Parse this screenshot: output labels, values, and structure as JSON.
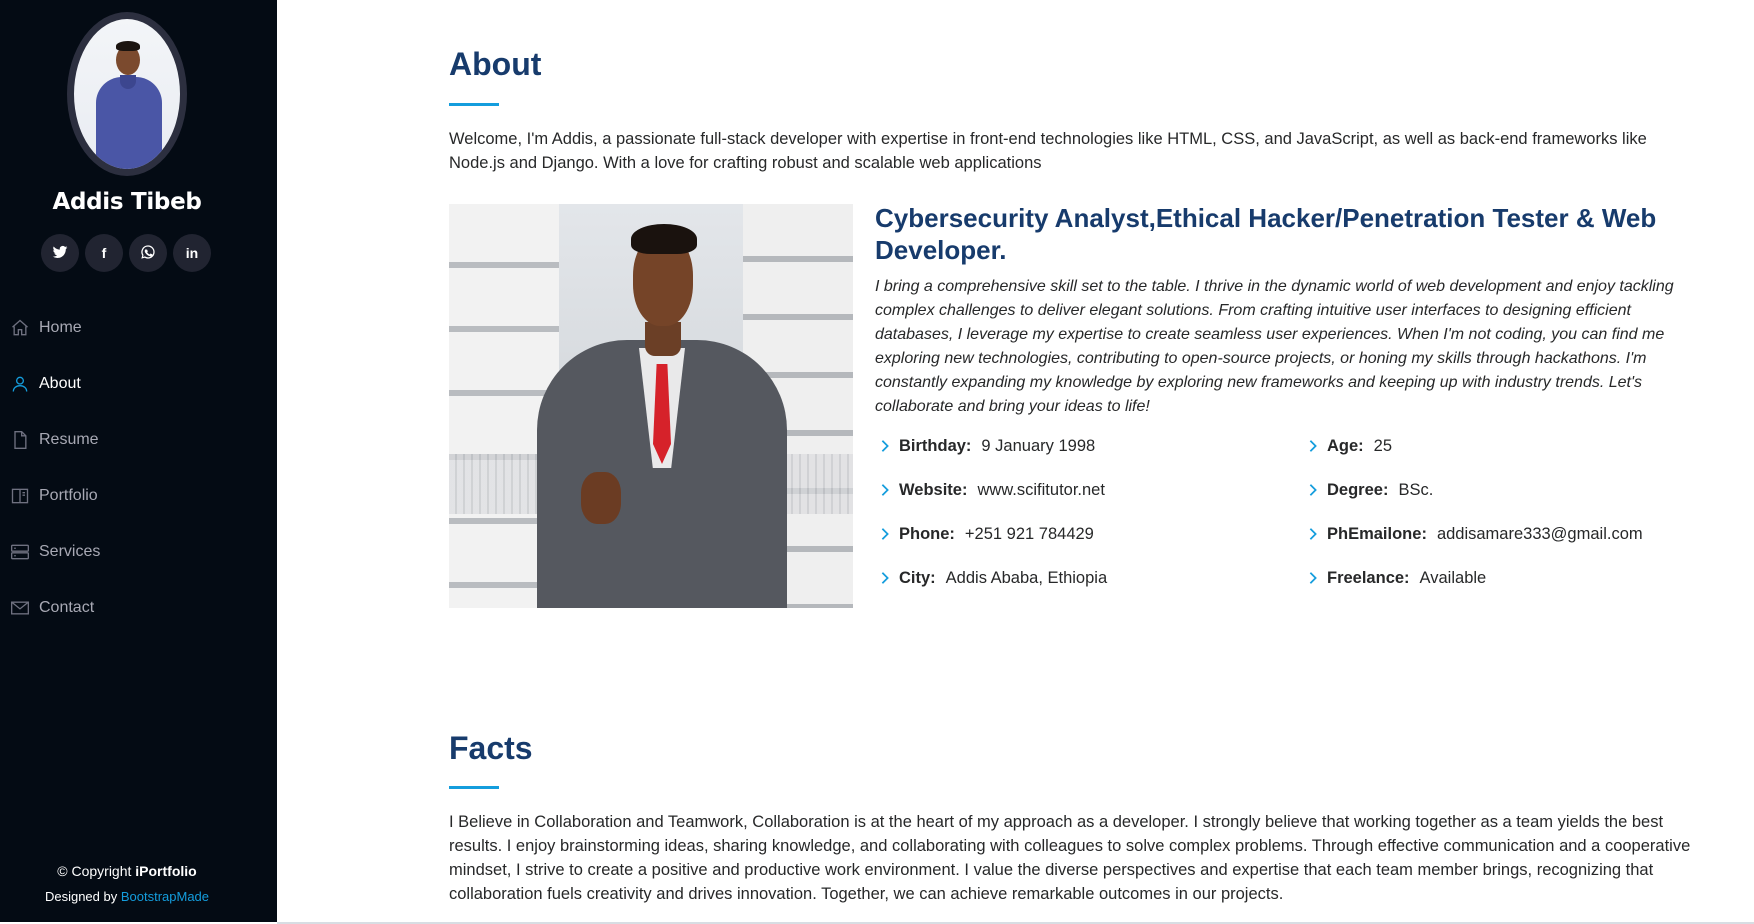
{
  "sidebar": {
    "name": "Addis Tibeb",
    "social": [
      {
        "icon": "twitter-icon",
        "glyph": ""
      },
      {
        "icon": "facebook-icon",
        "glyph": "f"
      },
      {
        "icon": "whatsapp-icon",
        "glyph": ""
      },
      {
        "icon": "linkedin-icon",
        "glyph": "in"
      }
    ],
    "nav": [
      {
        "label": "Home",
        "icon": "home-icon"
      },
      {
        "label": "About",
        "icon": "person-icon",
        "active": true
      },
      {
        "label": "Resume",
        "icon": "file-icon"
      },
      {
        "label": "Portfolio",
        "icon": "book-icon"
      },
      {
        "label": "Services",
        "icon": "server-icon"
      },
      {
        "label": "Contact",
        "icon": "envelope-icon"
      }
    ],
    "footer": {
      "copyright_prefix": "© Copyright",
      "brand": "iPortfolio",
      "designed_by": "Designed by",
      "designer": "BootstrapMade"
    }
  },
  "about": {
    "title": "About",
    "intro": "Welcome, I'm Addis, a passionate full-stack developer with expertise in front-end technologies like HTML, CSS, and JavaScript, as well as back-end frameworks like Node.js and Django. With a love for crafting robust and scalable web applications",
    "role_title": "Cybersecurity Analyst,Ethical Hacker/Penetration Tester & Web Developer.",
    "role_desc": "I bring a comprehensive skill set to the table. I thrive in the dynamic world of web development and enjoy tackling complex challenges to deliver elegant solutions. From crafting intuitive user interfaces to designing efficient databases, I leverage my expertise to create seamless user experiences. When I'm not coding, you can find me exploring new technologies, contributing to open-source projects, or honing my skills through hackathons. I'm constantly expanding my knowledge by exploring new frameworks and keeping up with industry trends. Let's collaborate and bring your ideas to life!",
    "info_left": [
      {
        "label": "Birthday:",
        "value": "9 January 1998"
      },
      {
        "label": "Website:",
        "value": "www.scifitutor.net"
      },
      {
        "label": "Phone:",
        "value": "+251 921 784429"
      },
      {
        "label": "City:",
        "value": "Addis Ababa, Ethiopia"
      }
    ],
    "info_right": [
      {
        "label": "Age:",
        "value": "25"
      },
      {
        "label": "Degree:",
        "value": "BSc."
      },
      {
        "label": "PhEmailone:",
        "value": "addisamare333@gmail.com"
      },
      {
        "label": "Freelance:",
        "value": "Available"
      }
    ]
  },
  "facts": {
    "title": "Facts",
    "text": "I Believe in Collaboration and Teamwork, Collaboration is at the heart of my approach as a developer. I strongly believe that working together as a team yields the best results. I enjoy brainstorming ideas, sharing knowledge, and collaborating with colleagues to solve complex problems. Through effective communication and a cooperative mindset, I strive to create a positive and productive work environment. I value the diverse perspectives and expertise that each team member brings, recognizing that collaboration fuels creativity and drives innovation. Together, we can achieve remarkable outcomes in our projects."
  },
  "colors": {
    "sidebar_bg": "#040b14",
    "accent": "#149ddd",
    "heading": "#173b6c"
  }
}
